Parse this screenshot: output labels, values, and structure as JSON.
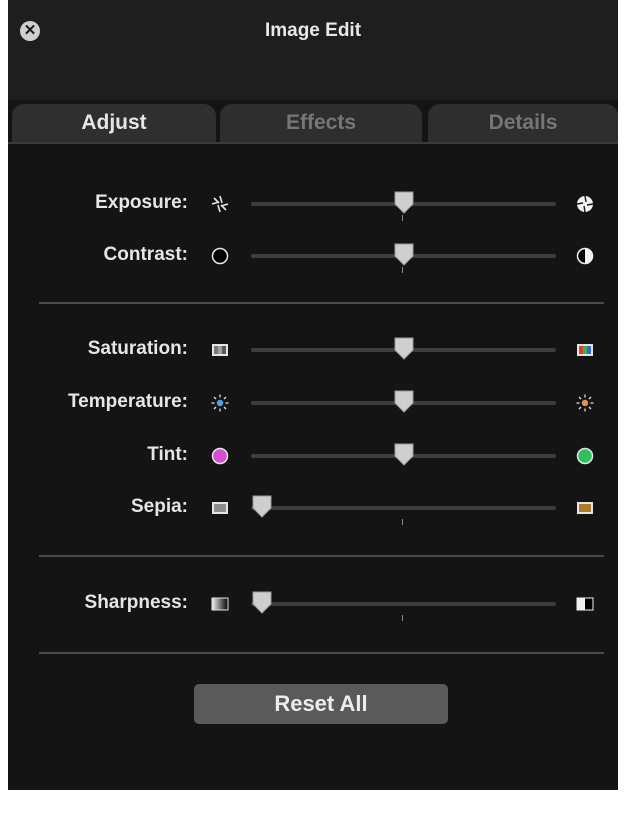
{
  "window": {
    "title": "Image Edit"
  },
  "tabs": [
    {
      "label": "Adjust",
      "active": true
    },
    {
      "label": "Effects",
      "active": false
    },
    {
      "label": "Details",
      "active": false
    }
  ],
  "sliders": {
    "exposure": {
      "label": "Exposure:",
      "value": 0.5,
      "left_icon": "aperture-open-icon",
      "right_icon": "aperture-closed-icon"
    },
    "contrast": {
      "label": "Contrast:",
      "value": 0.5,
      "left_icon": "filled-circle-icon",
      "right_icon": "half-circle-icon"
    },
    "saturation": {
      "label": "Saturation:",
      "value": 0.5,
      "left_icon": "desaturated-bars-icon",
      "right_icon": "color-bars-icon"
    },
    "temperature": {
      "label": "Temperature:",
      "value": 0.5,
      "left_icon": "cool-sun-icon",
      "right_icon": "warm-sun-icon"
    },
    "tint": {
      "label": "Tint:",
      "value": 0.5,
      "left_icon": "magenta-circle-icon",
      "right_icon": "green-circle-icon"
    },
    "sepia": {
      "label": "Sepia:",
      "value": 0.0,
      "left_icon": "gray-square-icon",
      "right_icon": "sepia-square-icon"
    },
    "sharpness": {
      "label": "Sharpness:",
      "value": 0.0,
      "left_icon": "soft-gradient-icon",
      "right_icon": "sharp-edge-icon"
    }
  },
  "buttons": {
    "reset_label": "Reset All"
  },
  "colors": {
    "panel_bg": "#141414",
    "track": "#3d3d3d",
    "thumb": "#cfcfcf",
    "button_bg": "#5a5a5a",
    "tint_left": "#d34fd0",
    "tint_right": "#2fc160",
    "temp_left": "#4ba3e0",
    "temp_right": "#e88c5a"
  }
}
